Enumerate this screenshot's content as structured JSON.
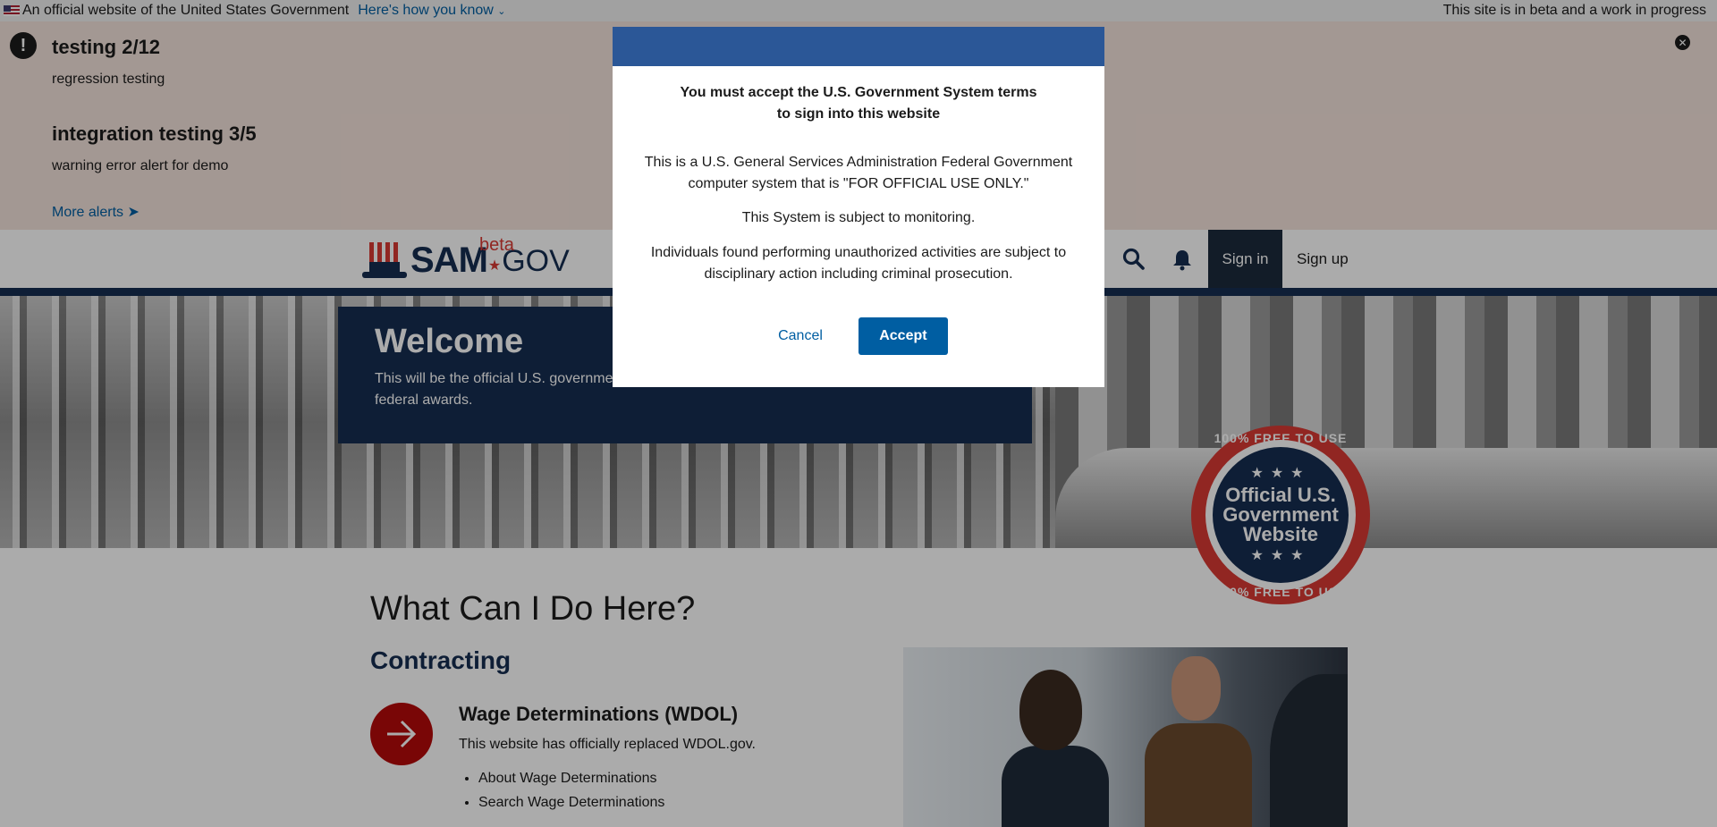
{
  "gov_banner": {
    "official_text": "An official website of the United States Government",
    "how_link": "Here's how you know",
    "beta_text": "This site is in beta and a work in progress"
  },
  "alerts": [
    {
      "title": "testing 2/12",
      "body": "regression testing"
    },
    {
      "title": "integration testing 3/5",
      "body": "warning error alert for demo"
    }
  ],
  "alerts_more": "More alerts",
  "header": {
    "logo_main": "SAM",
    "logo_dot": "★",
    "logo_suffix": "GOV",
    "logo_beta": "beta",
    "sign_in": "Sign in",
    "sign_up": "Sign up"
  },
  "hero": {
    "title": "Welcome",
    "text": "This will be the official U.S. government website for people who make, receive, and manage federal awards."
  },
  "seal": {
    "top_arc": "100% FREE TO USE",
    "line1": "Official U.S.",
    "line2": "Government",
    "line3": "Website",
    "stars": "★★★",
    "bottom_arc": "100% FREE TO USE"
  },
  "main": {
    "heading": "What Can I Do Here?",
    "section": "Contracting",
    "wd_title": "Wage Determinations (WDOL)",
    "wd_text": "This website has officially replaced WDOL.gov.",
    "wd_links": [
      "About Wage Determinations",
      "Search Wage Determinations"
    ]
  },
  "modal": {
    "title_line1": "You must accept the U.S. Government System terms",
    "title_line2": "to sign into this website",
    "para1_line1": "This is a U.S. General Services Administration Federal Government",
    "para1_line2": "computer system that is \"FOR OFFICIAL USE ONLY.\"",
    "para2": "This System is subject to monitoring.",
    "para3_line1": "Individuals found performing unauthorized activities are subject to",
    "para3_line2": "disciplinary action including criminal prosecution.",
    "cancel": "Cancel",
    "accept": "Accept"
  },
  "colors": {
    "primary": "#005ea2",
    "navy": "#162e51",
    "alert_bg": "#f4e3db",
    "modal_header": "#2b5797",
    "red": "#d83933"
  }
}
